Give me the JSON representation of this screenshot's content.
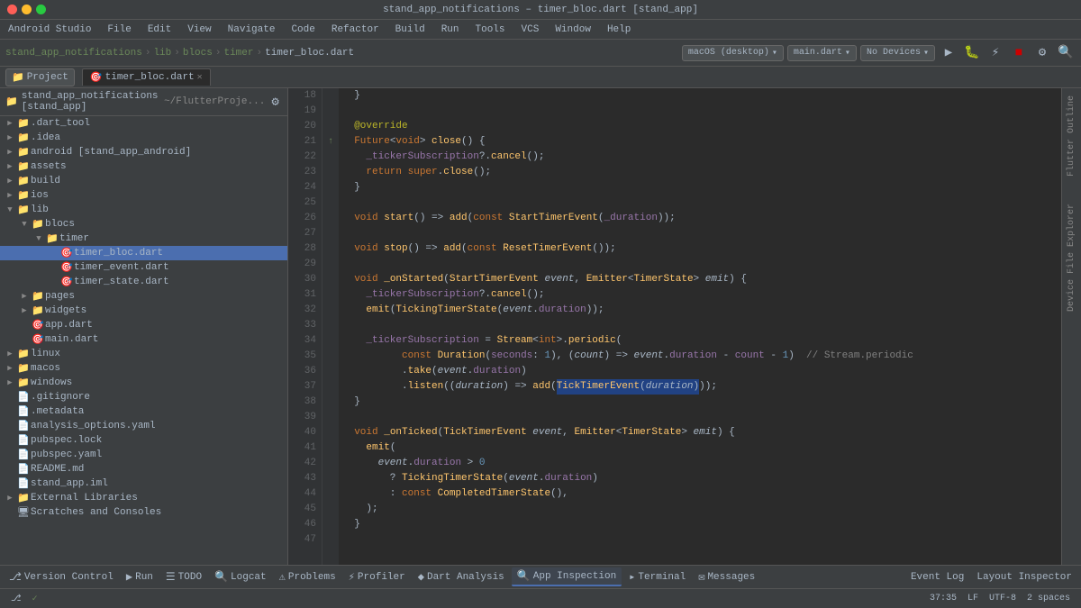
{
  "titleBar": {
    "title": "stand_app_notifications – timer_bloc.dart [stand_app]"
  },
  "menuBar": {
    "items": [
      "Android Studio",
      "File",
      "Edit",
      "View",
      "Navigate",
      "Code",
      "Refactor",
      "Build",
      "Run",
      "Tools",
      "VCS",
      "Window",
      "Help"
    ]
  },
  "breadcrumb": {
    "items": [
      "stand_app_notifications",
      "lib",
      "blocs",
      "timer",
      "timer_bloc.dart"
    ]
  },
  "tabs": [
    {
      "label": "timer_bloc.dart",
      "active": true,
      "modified": false
    }
  ],
  "projectPanel": {
    "title": "Project",
    "rootLabel": "stand_app_notifications [stand_app]",
    "rootSuffix": "~/FlutterProje..."
  },
  "sidebarTree": [
    {
      "indent": 0,
      "arrow": "▼",
      "icon": "📁",
      "label": ".dart_tool",
      "type": "folder"
    },
    {
      "indent": 0,
      "arrow": "▼",
      "icon": "📁",
      "label": ".idea",
      "type": "folder"
    },
    {
      "indent": 0,
      "arrow": "▼",
      "icon": "📁",
      "label": "android [stand_app_android]",
      "type": "folder"
    },
    {
      "indent": 0,
      "arrow": "▼",
      "icon": "📁",
      "label": "assets",
      "type": "folder"
    },
    {
      "indent": 0,
      "arrow": "▼",
      "icon": "📁",
      "label": "build",
      "type": "folder"
    },
    {
      "indent": 0,
      "arrow": "▼",
      "icon": "📁",
      "label": "ios",
      "type": "folder"
    },
    {
      "indent": 0,
      "arrow": "▼",
      "icon": "📁",
      "label": "lib",
      "type": "folder",
      "open": true
    },
    {
      "indent": 1,
      "arrow": "▼",
      "icon": "📁",
      "label": "blocs",
      "type": "folder",
      "open": true
    },
    {
      "indent": 2,
      "arrow": "▼",
      "icon": "📁",
      "label": "timer",
      "type": "folder",
      "open": true
    },
    {
      "indent": 3,
      "arrow": "",
      "icon": "🎯",
      "label": "timer_bloc.dart",
      "type": "dart",
      "selected": true
    },
    {
      "indent": 3,
      "arrow": "",
      "icon": "🎯",
      "label": "timer_event.dart",
      "type": "dart"
    },
    {
      "indent": 3,
      "arrow": "",
      "icon": "🎯",
      "label": "timer_state.dart",
      "type": "dart"
    },
    {
      "indent": 1,
      "arrow": "▶",
      "icon": "📁",
      "label": "pages",
      "type": "folder"
    },
    {
      "indent": 1,
      "arrow": "▶",
      "icon": "📁",
      "label": "widgets",
      "type": "folder"
    },
    {
      "indent": 1,
      "arrow": "",
      "icon": "🎯",
      "label": "app.dart",
      "type": "dart"
    },
    {
      "indent": 1,
      "arrow": "",
      "icon": "🎯",
      "label": "main.dart",
      "type": "dart"
    },
    {
      "indent": 0,
      "arrow": "▶",
      "icon": "📁",
      "label": "linux",
      "type": "folder"
    },
    {
      "indent": 0,
      "arrow": "▶",
      "icon": "📁",
      "label": "macos",
      "type": "folder"
    },
    {
      "indent": 0,
      "arrow": "▶",
      "icon": "📁",
      "label": "windows",
      "type": "folder"
    },
    {
      "indent": 0,
      "arrow": "",
      "icon": "📄",
      "label": ".gitignore",
      "type": "file"
    },
    {
      "indent": 0,
      "arrow": "",
      "icon": "📄",
      "label": ".metadata",
      "type": "file"
    },
    {
      "indent": 0,
      "arrow": "",
      "icon": "📄",
      "label": "analysis_options.yaml",
      "type": "file"
    },
    {
      "indent": 0,
      "arrow": "",
      "icon": "📄",
      "label": "pubspec.lock",
      "type": "file"
    },
    {
      "indent": 0,
      "arrow": "",
      "icon": "📄",
      "label": "pubspec.yaml",
      "type": "file"
    },
    {
      "indent": 0,
      "arrow": "",
      "icon": "📄",
      "label": "README.md",
      "type": "file"
    },
    {
      "indent": 0,
      "arrow": "",
      "icon": "📄",
      "label": "stand_app.iml",
      "type": "file"
    },
    {
      "indent": 0,
      "arrow": "▶",
      "icon": "📁",
      "label": "External Libraries",
      "type": "folder"
    },
    {
      "indent": 0,
      "arrow": "",
      "icon": "🖥",
      "label": "Scratches and Consoles",
      "type": "scratch"
    }
  ],
  "codeLines": [
    {
      "num": 18,
      "foldable": false,
      "gutter": "",
      "code": "  }"
    },
    {
      "num": 19,
      "foldable": false,
      "gutter": "",
      "code": ""
    },
    {
      "num": 20,
      "foldable": false,
      "gutter": "",
      "code": "  @override"
    },
    {
      "num": 21,
      "foldable": false,
      "gutter": "override",
      "code": "  Future<void> close() {"
    },
    {
      "num": 22,
      "foldable": false,
      "gutter": "",
      "code": "    _tickerSubscription?.cancel();"
    },
    {
      "num": 23,
      "foldable": false,
      "gutter": "",
      "code": "    return super.close();"
    },
    {
      "num": 24,
      "foldable": false,
      "gutter": "",
      "code": "  }"
    },
    {
      "num": 25,
      "foldable": false,
      "gutter": "",
      "code": ""
    },
    {
      "num": 26,
      "foldable": false,
      "gutter": "",
      "code": "  void start() => add(const StartTimerEvent(_duration));"
    },
    {
      "num": 27,
      "foldable": false,
      "gutter": "",
      "code": ""
    },
    {
      "num": 28,
      "foldable": false,
      "gutter": "",
      "code": "  void stop() => add(const ResetTimerEvent());"
    },
    {
      "num": 29,
      "foldable": false,
      "gutter": "",
      "code": ""
    },
    {
      "num": 30,
      "foldable": false,
      "gutter": "",
      "code": "  void _onStarted(StartTimerEvent event, Emitter<TimerState> emit) {"
    },
    {
      "num": 31,
      "foldable": false,
      "gutter": "",
      "code": "    _tickerSubscription?.cancel();"
    },
    {
      "num": 32,
      "foldable": false,
      "gutter": "",
      "code": "    emit(TickingTimerState(event.duration));"
    },
    {
      "num": 33,
      "foldable": false,
      "gutter": "",
      "code": ""
    },
    {
      "num": 34,
      "foldable": true,
      "gutter": "",
      "code": "    _tickerSubscription = Stream<int>.periodic("
    },
    {
      "num": 35,
      "foldable": false,
      "gutter": "",
      "code": "        const Duration(seconds: 1), (count) => event.duration - count - 1)  // Stream.periodic"
    },
    {
      "num": 36,
      "foldable": false,
      "gutter": "",
      "code": "        .take(event.duration)"
    },
    {
      "num": 37,
      "foldable": false,
      "gutter": "",
      "code": "        .listen((duration) => add(TickTimerEvent(duration)));"
    },
    {
      "num": 38,
      "foldable": false,
      "gutter": "",
      "code": "  }"
    },
    {
      "num": 39,
      "foldable": false,
      "gutter": "",
      "code": ""
    },
    {
      "num": 40,
      "foldable": false,
      "gutter": "",
      "code": "  void _onTicked(TickTimerEvent event, Emitter<TimerState> emit) {"
    },
    {
      "num": 41,
      "foldable": false,
      "gutter": "",
      "code": "    emit("
    },
    {
      "num": 42,
      "foldable": false,
      "gutter": "",
      "code": "      event.duration > 0"
    },
    {
      "num": 43,
      "foldable": false,
      "gutter": "",
      "code": "        ? TickingTimerState(event.duration)"
    },
    {
      "num": 44,
      "foldable": false,
      "gutter": "",
      "code": "        : const CompletedTimerState(),"
    },
    {
      "num": 45,
      "foldable": false,
      "gutter": "",
      "code": "    );"
    },
    {
      "num": 46,
      "foldable": false,
      "gutter": "",
      "code": "  }"
    },
    {
      "num": 47,
      "foldable": false,
      "gutter": "",
      "code": ""
    }
  ],
  "bottomBar": {
    "buttons": [
      {
        "icon": "⎇",
        "label": "Version Control"
      },
      {
        "icon": "▶",
        "label": "Run",
        "active": false
      },
      {
        "icon": "☰",
        "label": "TODO"
      },
      {
        "icon": "🔍",
        "label": "Logcat"
      },
      {
        "icon": "⚠",
        "label": "Problems"
      },
      {
        "icon": "⚡",
        "label": "Profiler"
      },
      {
        "icon": "◆",
        "label": "Dart Analysis"
      },
      {
        "icon": "🔍",
        "label": "App Inspection",
        "active": true
      },
      {
        "icon": "▸",
        "label": "Terminal"
      },
      {
        "icon": "✉",
        "label": "Messages"
      }
    ]
  },
  "statusBar": {
    "left": [
      {
        "label": "37:35"
      },
      {
        "label": "LF"
      },
      {
        "label": "UTF-8"
      },
      {
        "label": "2 spaces"
      }
    ],
    "eventLog": "Event Log",
    "layoutInspector": "Layout Inspector"
  },
  "rightPanel": {
    "flutter": "Flutter Outline",
    "deviceFileExplorer": "Device File Explorer"
  },
  "toolbar2": {
    "project": "Project",
    "macOS": "macOS (desktop)",
    "mainDart": "main.dart",
    "noDevices": "No Devices"
  }
}
